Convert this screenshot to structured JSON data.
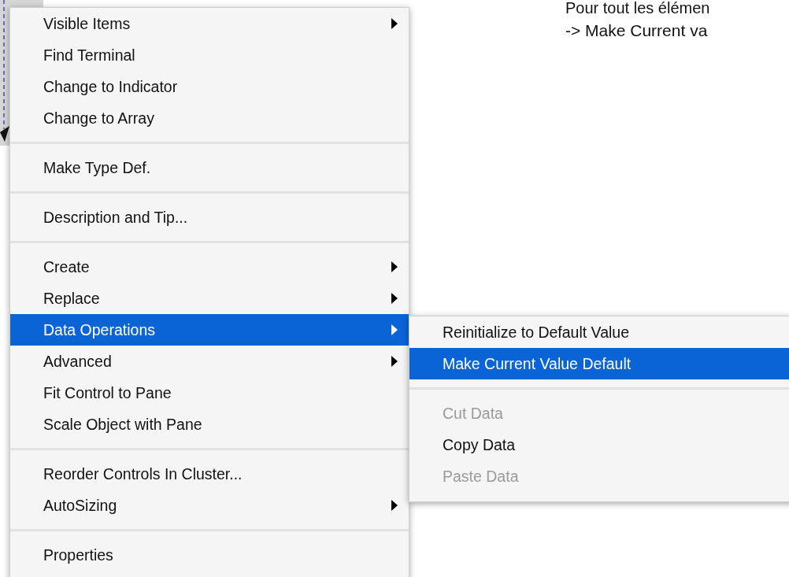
{
  "note": {
    "line_1": "Pour tout les élémen",
    "line_2": "-> Make Current va"
  },
  "context_menu": {
    "items": [
      {
        "kind": "item",
        "label": "Visible Items",
        "has_submenu": true,
        "selected": false,
        "disabled": false
      },
      {
        "kind": "item",
        "label": "Find Terminal",
        "has_submenu": false,
        "selected": false,
        "disabled": false
      },
      {
        "kind": "item",
        "label": "Change to Indicator",
        "has_submenu": false,
        "selected": false,
        "disabled": false
      },
      {
        "kind": "item",
        "label": "Change to Array",
        "has_submenu": false,
        "selected": false,
        "disabled": false
      },
      {
        "kind": "separator"
      },
      {
        "kind": "item",
        "label": "Make Type Def.",
        "has_submenu": false,
        "selected": false,
        "disabled": false
      },
      {
        "kind": "separator"
      },
      {
        "kind": "item",
        "label": "Description and Tip...",
        "has_submenu": false,
        "selected": false,
        "disabled": false
      },
      {
        "kind": "separator"
      },
      {
        "kind": "item",
        "label": "Create",
        "has_submenu": true,
        "selected": false,
        "disabled": false
      },
      {
        "kind": "item",
        "label": "Replace",
        "has_submenu": true,
        "selected": false,
        "disabled": false
      },
      {
        "kind": "item",
        "label": "Data Operations",
        "has_submenu": true,
        "selected": true,
        "disabled": false
      },
      {
        "kind": "item",
        "label": "Advanced",
        "has_submenu": true,
        "selected": false,
        "disabled": false
      },
      {
        "kind": "item",
        "label": "Fit Control to Pane",
        "has_submenu": false,
        "selected": false,
        "disabled": false
      },
      {
        "kind": "item",
        "label": "Scale Object with Pane",
        "has_submenu": false,
        "selected": false,
        "disabled": false
      },
      {
        "kind": "separator"
      },
      {
        "kind": "item",
        "label": "Reorder Controls In Cluster...",
        "has_submenu": false,
        "selected": false,
        "disabled": false
      },
      {
        "kind": "item",
        "label": "AutoSizing",
        "has_submenu": true,
        "selected": false,
        "disabled": false
      },
      {
        "kind": "separator"
      },
      {
        "kind": "item",
        "label": "Properties",
        "has_submenu": false,
        "selected": false,
        "disabled": false
      }
    ]
  },
  "submenu": {
    "items": [
      {
        "kind": "item",
        "label": "Reinitialize to Default Value",
        "has_submenu": false,
        "selected": false,
        "disabled": false
      },
      {
        "kind": "item",
        "label": "Make Current Value Default",
        "has_submenu": false,
        "selected": true,
        "disabled": false
      },
      {
        "kind": "separator"
      },
      {
        "kind": "item",
        "label": "Cut Data",
        "has_submenu": false,
        "selected": false,
        "disabled": true
      },
      {
        "kind": "item",
        "label": "Copy Data",
        "has_submenu": false,
        "selected": false,
        "disabled": false
      },
      {
        "kind": "item",
        "label": "Paste Data",
        "has_submenu": false,
        "selected": false,
        "disabled": true
      }
    ]
  }
}
